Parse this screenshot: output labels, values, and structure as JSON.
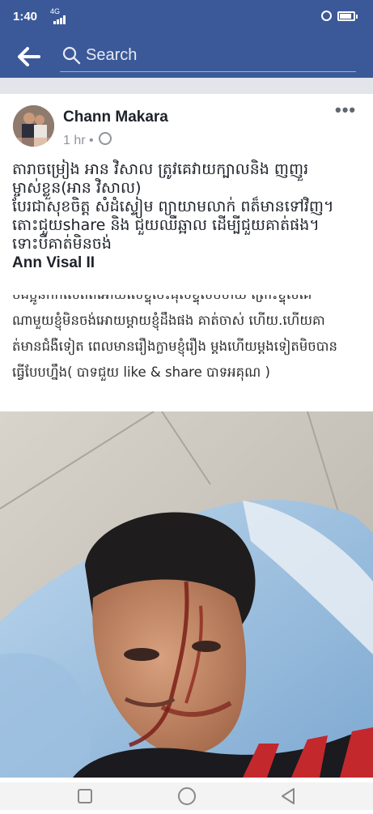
{
  "status_bar": {
    "time": "1:40",
    "network": "4G",
    "icons": [
      "signal-icon",
      "alarm-icon",
      "battery-icon"
    ]
  },
  "app_bar": {
    "back_icon": "arrow-left-icon",
    "search_icon": "search-icon",
    "search_placeholder": "Search",
    "color": "#3b5998"
  },
  "post": {
    "author": "Chann Makara",
    "time": "1 hr",
    "separator": "•",
    "privacy_icon": "globe-icon",
    "more_icon": "more-dots-icon",
    "text_lines": [
      "តារាចម្រៀង អាន វិសាល ត្រូវគេវាយក្បាលនិង ញញួរ",
      "ម្ចាស់ខ្លួន(អាន វិសាល)",
      "បែរជាសុខចិត្ត សំដំស្ទៀម ព្យាយាមលាក់ ពត៏មានទៅវិញ។",
      "តោះជួយshare និង ជួយឈឺឆ្អាល ដើម្បីជួយគាត់ផង។",
      "ទោះបីគាត់មិនចង់"
    ],
    "quoted_name": "Ann Visal II",
    "screenshot_lines": [
      "បងប្អូនកក់សេតតអោយលេខ្ទុចេះផុសខ្ទុសបហយ ព្រោះខ្ទុំសគេ",
      "ណាមួយខ្ញុំមិនចង់អោយម្ដាយខ្ញុំដឹងផង គាត់ចាស់ ហើយ.ហើយគា",
      "ត់មានជំងឺទៀត ពេលមានរឿងក្លាមខ្ញុំរឿង ម្ដងហើយម្ដងទៀតមិចបាន",
      "ធ្វើបែបហ្នឹង( បាទជួយ like & share បាទអគុណ  )"
    ],
    "photo_alt": "injured man lying on hospital bed"
  },
  "nav_bar": {
    "icons": [
      "recent-apps-icon",
      "home-icon",
      "back-triangle-icon"
    ]
  }
}
